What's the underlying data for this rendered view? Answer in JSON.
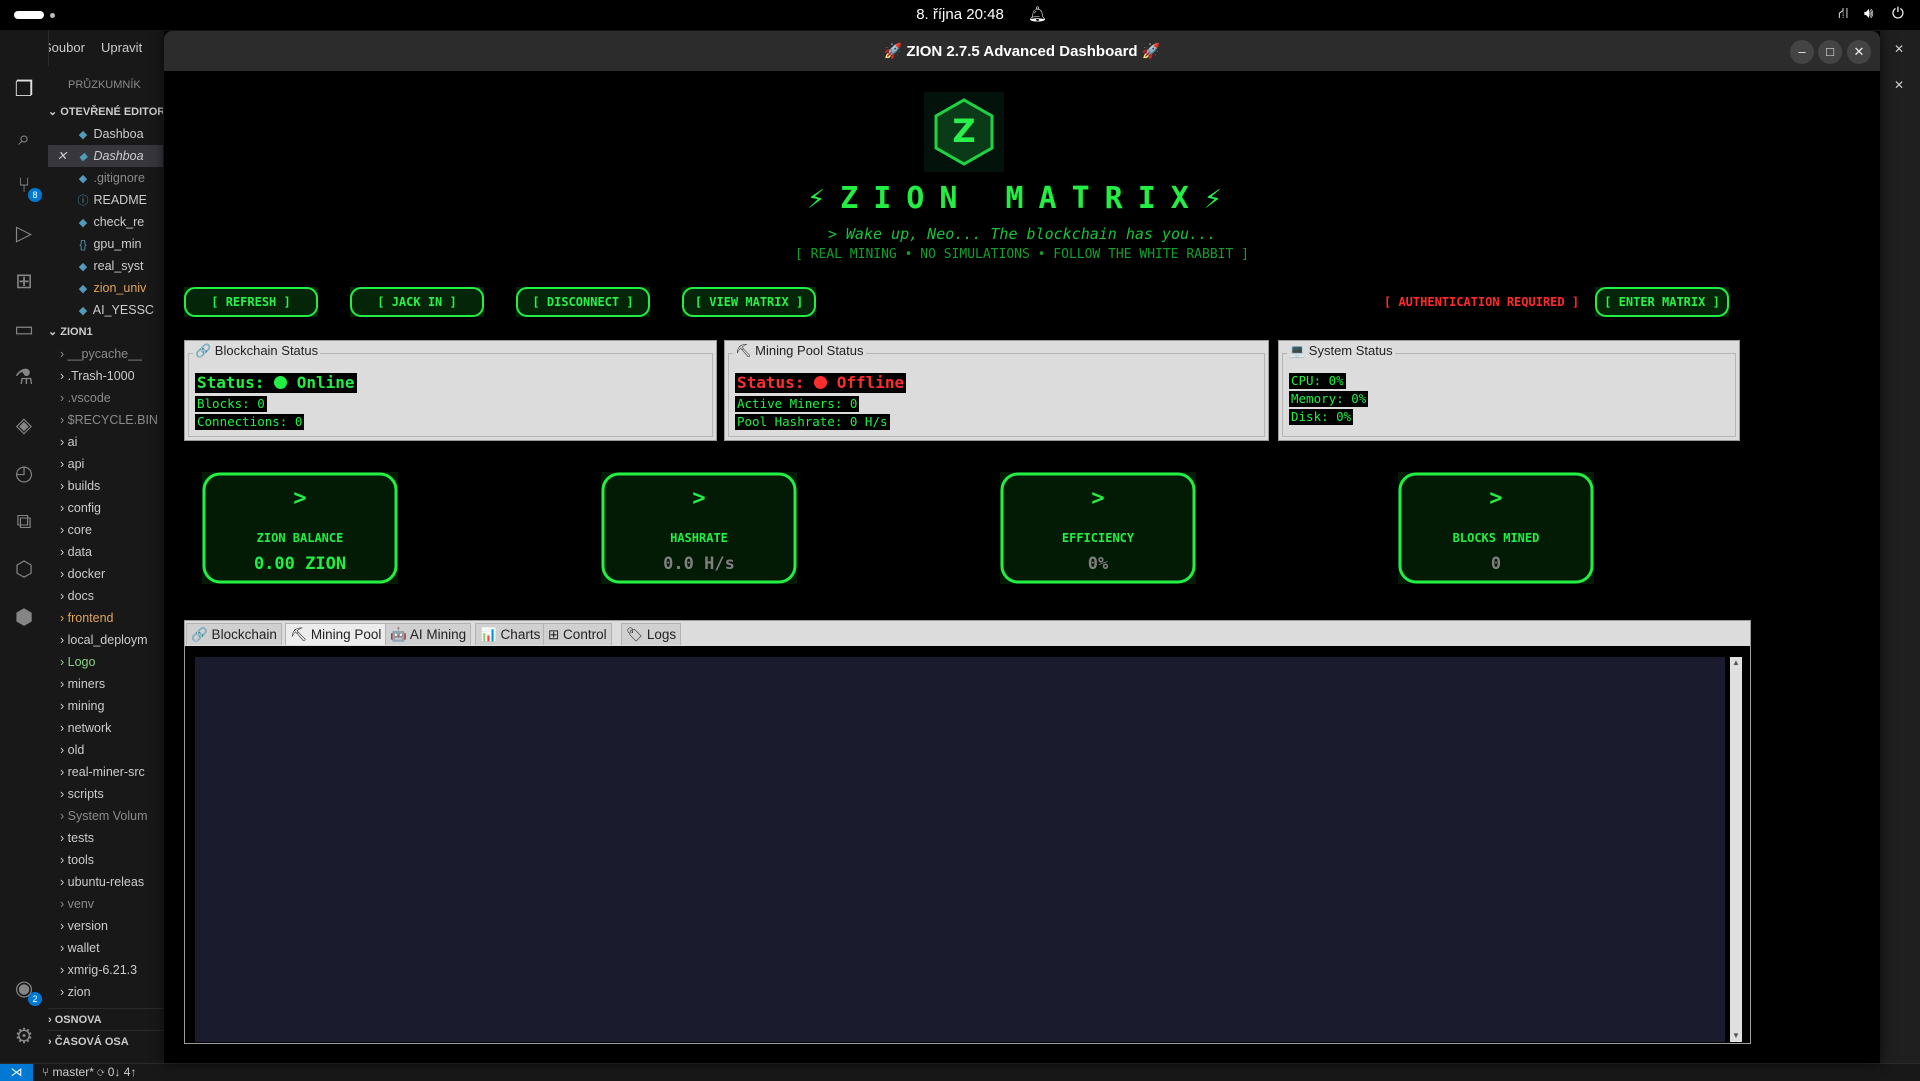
{
  "system_bar": {
    "clock": "8. října  20:48",
    "tray_icons": [
      "network-icon",
      "volume-icon",
      "power-icon"
    ]
  },
  "vscode": {
    "menu": [
      "Soubor",
      "Upravit"
    ],
    "explorer_title": "PRŮZKUMNÍK",
    "open_editors_title": "OTEVŘENÉ EDITORY",
    "open_editors": [
      "Dashboa",
      "Dashboa",
      ".gitignore",
      "README",
      "check_re",
      "gpu_min",
      "real_syst",
      "zion_univ",
      "AI_YESSC"
    ],
    "workspace_title": "ZION1",
    "folders": [
      "__pycache__",
      ".Trash-1000",
      ".vscode",
      "$RECYCLE.BIN",
      "ai",
      "api",
      "builds",
      "config",
      "core",
      "data",
      "docker",
      "docs",
      "frontend",
      "local_deploym",
      "Logo",
      "miners",
      "mining",
      "network",
      "old",
      "real-miner-src",
      "scripts",
      "System Volum",
      "tests",
      "tools",
      "ubuntu-releas",
      "venv",
      "version",
      "wallet",
      "xmrig-6.21.3",
      "zion"
    ],
    "outline_title": "OSNOVA",
    "timeline_title": "ČASOVÁ OSA",
    "source_control_badge": "8",
    "accounts_badge": "2",
    "status_branch": "master*",
    "status_sync": "0↓ 4↑"
  },
  "window": {
    "title": "🚀 ZION 2.7.5 Advanced Dashboard 🚀"
  },
  "hero": {
    "logo_letter": "Z",
    "title": "⚡ZION MATRIX⚡",
    "subtitle": "> Wake up, Neo... The blockchain has you...",
    "tagline": "[ REAL MINING • NO SIMULATIONS • FOLLOW THE WHITE RABBIT ]"
  },
  "buttons": {
    "refresh": "[ REFRESH ]",
    "jack_in": "[ JACK IN ]",
    "disconnect": "[ DISCONNECT ]",
    "view_matrix": "[ VIEW MATRIX ]",
    "auth_required": "[ AUTHENTICATION REQUIRED ]",
    "enter_matrix": "[ ENTER MATRIX ]"
  },
  "panels": {
    "blockchain": {
      "title": "🔗 Blockchain Status",
      "status_label": "Status:",
      "status_value": "Online",
      "blocks": "Blocks: 0",
      "connections": "Connections: 0"
    },
    "pool": {
      "title": "⛏ Mining Pool Status",
      "status_label": "Status:",
      "status_value": "Offline",
      "active_miners": "Active Miners: 0",
      "pool_hashrate": "Pool Hashrate: 0 H/s"
    },
    "system": {
      "title": "💻 System Status",
      "cpu": "CPU: 0%",
      "memory": "Memory: 0%",
      "disk": "Disk: 0%"
    }
  },
  "cards": [
    {
      "arrow": ">",
      "label": "ZION BALANCE",
      "value": "0.00 ZION"
    },
    {
      "arrow": ">",
      "label": "HASHRATE",
      "value": "0.0 H/s"
    },
    {
      "arrow": ">",
      "label": "EFFICIENCY",
      "value": "0%"
    },
    {
      "arrow": ">",
      "label": "BLOCKS MINED",
      "value": "0"
    }
  ],
  "tabs": [
    "🔗 Blockchain",
    "⛏ Mining Pool",
    "🤖 AI Mining",
    "📊 Charts",
    "⊞ Control",
    "🏷 Logs"
  ],
  "colors": {
    "matrix_green": "#22ee44",
    "online": "#22ee44",
    "offline": "#ff2e2e",
    "tab_content_bg": "#1b1b2e"
  }
}
